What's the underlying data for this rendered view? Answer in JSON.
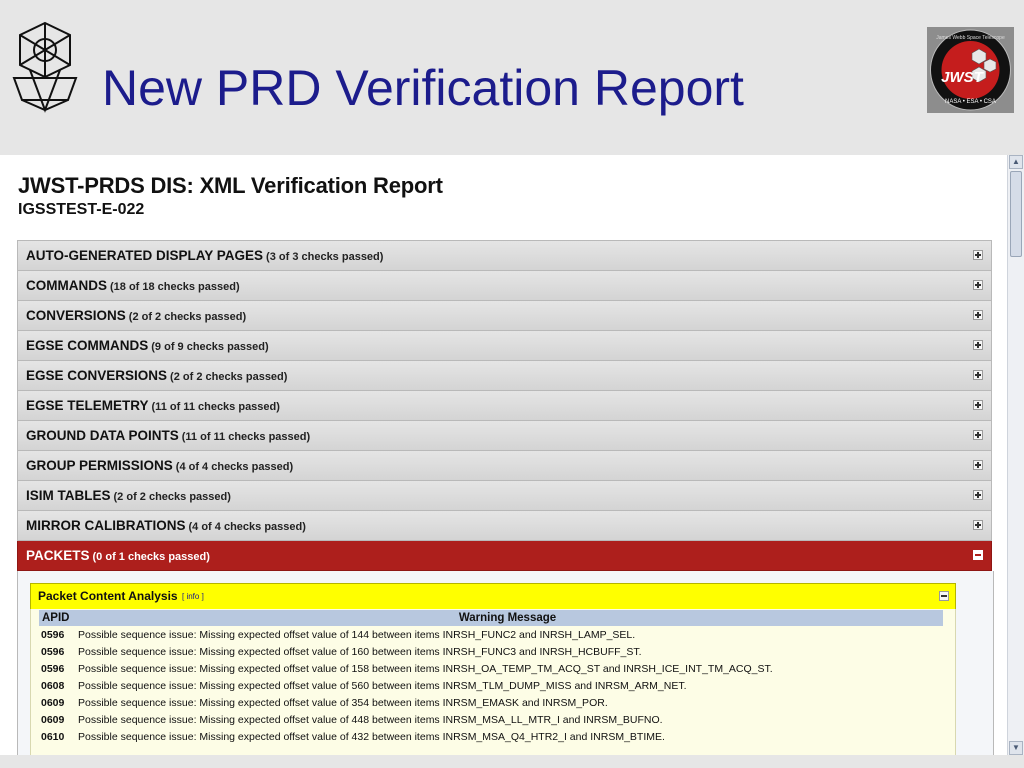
{
  "slide": {
    "title": "New PRD Verification Report",
    "logo_text": "JWST",
    "logo_ring_text": "James Webb Space Telescope",
    "logo_agencies": "NASA • ESA • CSA"
  },
  "report": {
    "title": "JWST-PRDS DIS: XML Verification Report",
    "id": "IGSSTEST-E-022"
  },
  "sections": [
    {
      "name": "AUTO-GENERATED DISPLAY PAGES",
      "count": "(3 of 3 checks passed)"
    },
    {
      "name": "COMMANDS",
      "count": "(18 of 18 checks passed)"
    },
    {
      "name": "CONVERSIONS",
      "count": "(2 of 2 checks passed)"
    },
    {
      "name": "EGSE COMMANDS",
      "count": "(9 of 9 checks passed)"
    },
    {
      "name": "EGSE CONVERSIONS",
      "count": "(2 of 2 checks passed)"
    },
    {
      "name": "EGSE TELEMETRY",
      "count": "(11 of 11 checks passed)"
    },
    {
      "name": "GROUND DATA POINTS",
      "count": "(11 of 11 checks passed)"
    },
    {
      "name": "GROUP PERMISSIONS",
      "count": "(4 of 4 checks passed)"
    },
    {
      "name": "ISIM TABLES",
      "count": "(2 of 2 checks passed)"
    },
    {
      "name": "MIRROR CALIBRATIONS",
      "count": "(4 of 4 checks passed)"
    },
    {
      "name": "PACKETS",
      "count": "(0 of 1 checks passed)"
    }
  ],
  "packet_analysis": {
    "title": "Packet Content Analysis",
    "info_link": "[ info ]",
    "columns": [
      "APID",
      "Warning Message"
    ],
    "rows": [
      [
        "0596",
        "Possible sequence issue: Missing expected offset value of 144 between items INRSH_FUNC2 and INRSH_LAMP_SEL."
      ],
      [
        "0596",
        "Possible sequence issue: Missing expected offset value of 160 between items INRSH_FUNC3 and INRSH_HCBUFF_ST."
      ],
      [
        "0596",
        "Possible sequence issue: Missing expected offset value of 158 between items INRSH_OA_TEMP_TM_ACQ_ST and INRSH_ICE_INT_TM_ACQ_ST."
      ],
      [
        "0608",
        "Possible sequence issue: Missing expected offset value of 560 between items INRSM_TLM_DUMP_MISS and INRSM_ARM_NET."
      ],
      [
        "0609",
        "Possible sequence issue: Missing expected offset value of 354 between items INRSM_EMASK and INRSM_POR."
      ],
      [
        "0609",
        "Possible sequence issue: Missing expected offset value of 448 between items INRSM_MSA_LL_MTR_I and INRSM_BUFNO."
      ],
      [
        "0610",
        "Possible sequence issue: Missing expected offset value of 432 between items INRSM_MSA_Q4_HTR2_I and INRSM_BTIME."
      ]
    ]
  },
  "colors": {
    "slide_title": "#1c1c8c",
    "failed_section": "#ad1f1c",
    "analysis_header": "#ffff00",
    "table_header": "#b8c8df"
  }
}
